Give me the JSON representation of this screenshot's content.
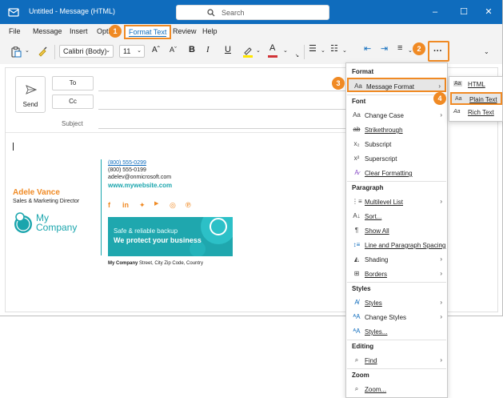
{
  "titlebar": {
    "title": "Untitled - Message (HTML)",
    "search_placeholder": "Search",
    "minimize": "–",
    "maximize": "☐",
    "close": "✕"
  },
  "menubar": {
    "items": [
      "File",
      "Message",
      "Insert",
      "Opti",
      "Format Text",
      "Review",
      "Help"
    ]
  },
  "ribbon": {
    "font_name": "Calibri (Body)",
    "font_size": "11",
    "more_label": "···"
  },
  "callouts": [
    "1",
    "2",
    "3",
    "4"
  ],
  "compose": {
    "send": "Send",
    "to": "To",
    "cc": "Cc",
    "subject": "Subject"
  },
  "signature": {
    "name": "Adele Vance",
    "role": "Sales & Marketing Director",
    "company": "My\nCompany",
    "phone1": "(800) 555-0299",
    "phone2": "(800) 555-0199",
    "email": "adelev@onmicrosoft.com",
    "website": "www.mywebsite.com",
    "banner_line1": "Safe & reliable backup",
    "banner_line2": "We protect your business",
    "address_company": "My Company",
    "address_rest": " Street, City Zip Code, Country"
  },
  "menu": {
    "format_header": "Format",
    "message_format": "Message Format",
    "font_header": "Font",
    "change_case": "Change Case",
    "strikethrough": "Strikethrough",
    "subscript": "Subscript",
    "superscript": "Superscript",
    "clear_formatting": "Clear Formatting",
    "paragraph_header": "Paragraph",
    "multilevel_list": "Multilevel List",
    "sort": "Sort...",
    "show_all": "Show All",
    "line_spacing": "Line and Paragraph Spacing",
    "shading": "Shading",
    "borders": "Borders",
    "styles_header": "Styles",
    "styles": "Styles",
    "change_styles": "Change Styles",
    "styles_dots": "Styles...",
    "editing_header": "Editing",
    "find": "Find",
    "zoom_header": "Zoom",
    "zoom": "Zoom..."
  },
  "submenu": {
    "html": "HTML",
    "plain_text": "Plain Text",
    "rich_text": "Rich Text"
  },
  "colors": {
    "brand": "#0f6cbd",
    "callout": "#f08a24",
    "teal": "#1aa5ad"
  }
}
